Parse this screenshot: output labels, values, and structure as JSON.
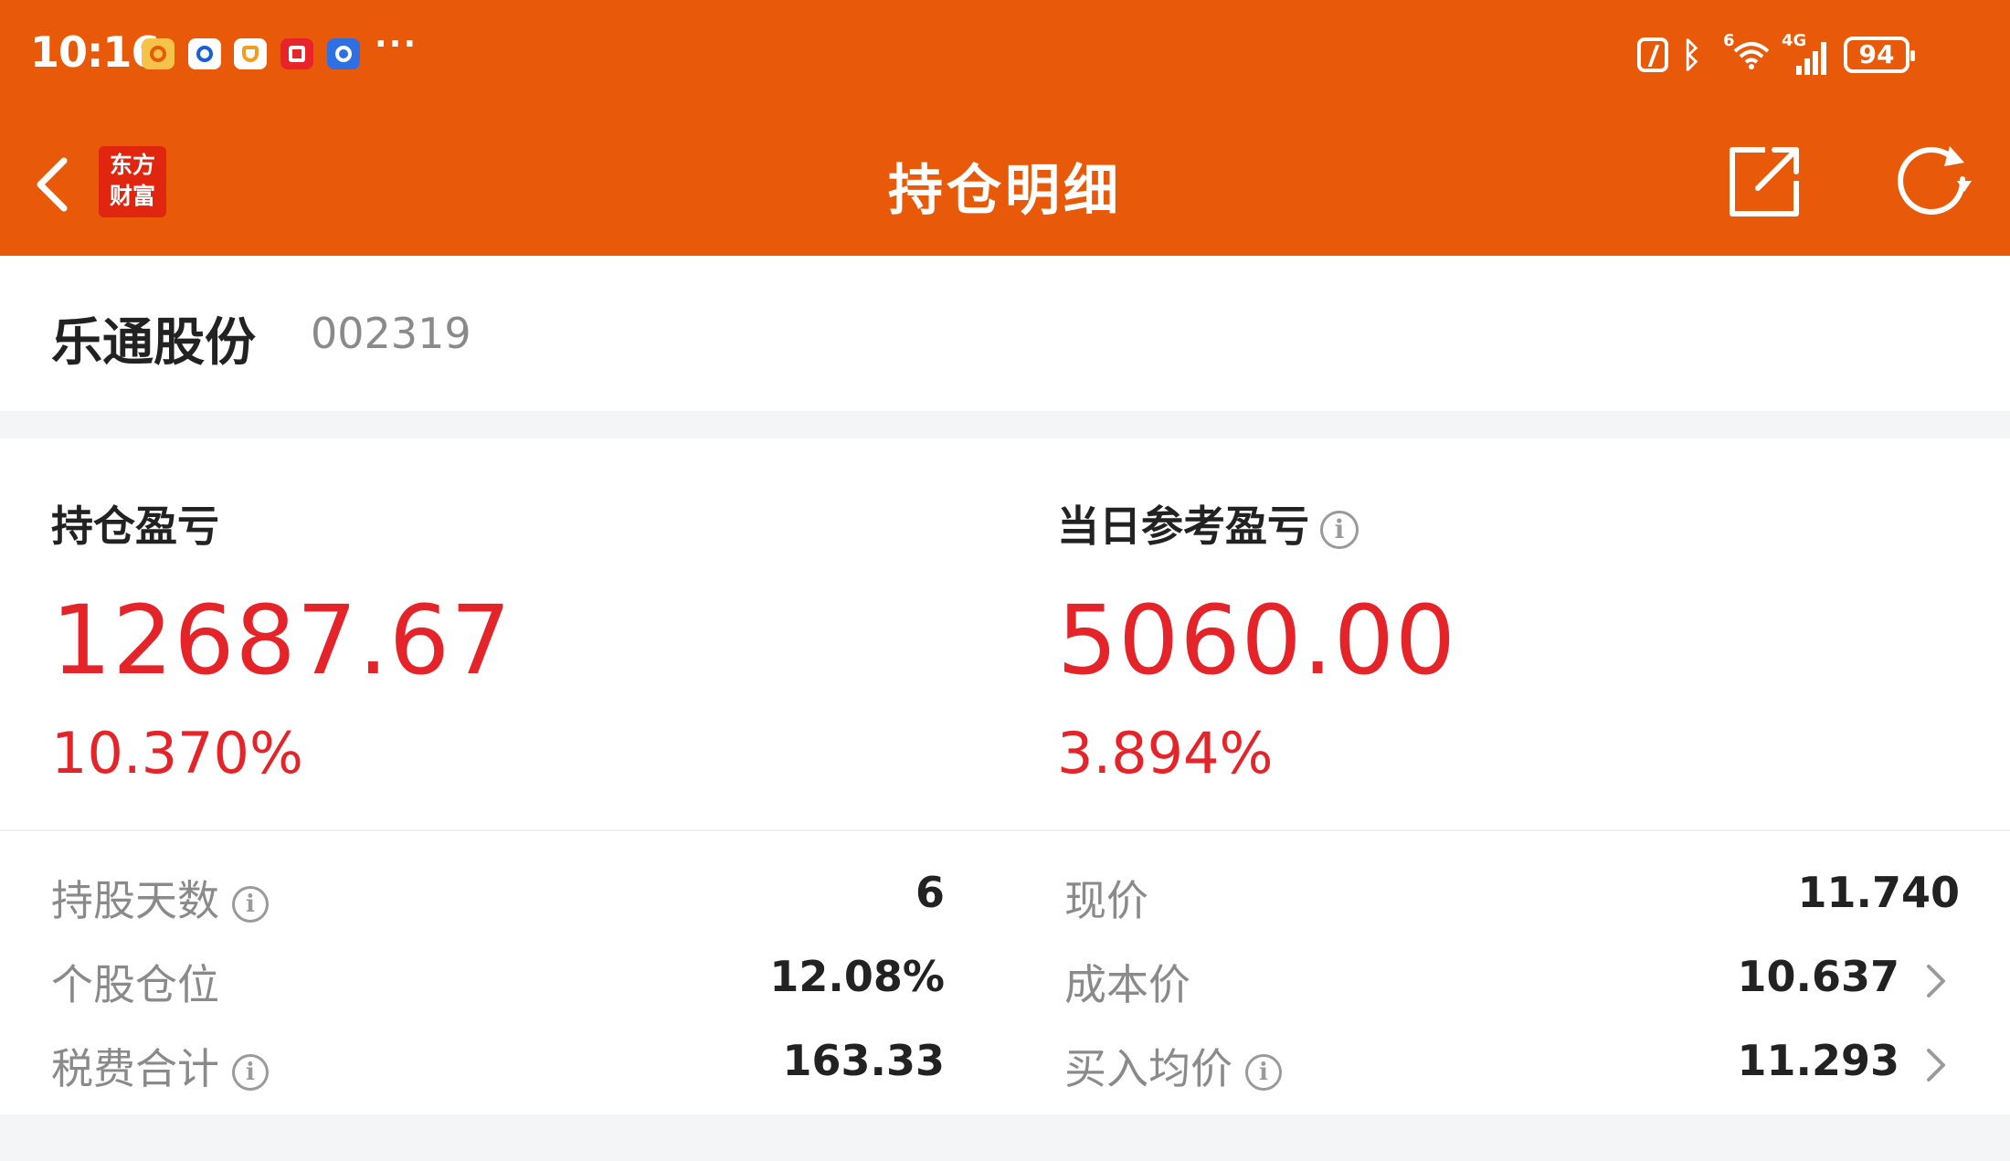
{
  "status_bar": {
    "time": "10:16",
    "battery": "94",
    "network": "4G",
    "wifi_sup": "6",
    "more": "···"
  },
  "nav": {
    "logo_line1": "东方",
    "logo_line2": "财富",
    "title": "持仓明细",
    "icons": [
      "back-arrow-icon",
      "share-icon",
      "refresh-icon"
    ]
  },
  "stock": {
    "name": "乐通股份",
    "code": "002319"
  },
  "pnl": {
    "position_label": "持仓盈亏",
    "position_value": "12687.67",
    "position_pct": "10.370%",
    "daily_label": "当日参考盈亏",
    "daily_value": "5060.00",
    "daily_pct": "3.894%"
  },
  "details": {
    "hold_days_label": "持股天数",
    "hold_days_value": "6",
    "position_ratio_label": "个股仓位",
    "position_ratio_value": "12.08%",
    "fees_label": "税费合计",
    "fees_value": "163.33",
    "current_price_label": "现价",
    "current_price_value": "11.740",
    "cost_price_label": "成本价",
    "cost_price_value": "10.637",
    "avg_buy_label": "买入均价",
    "avg_buy_value": "11.293"
  },
  "colors": {
    "brand_orange": "#e85a0a",
    "profit_red": "#e5242a",
    "label_gray": "#8a8a8a"
  }
}
